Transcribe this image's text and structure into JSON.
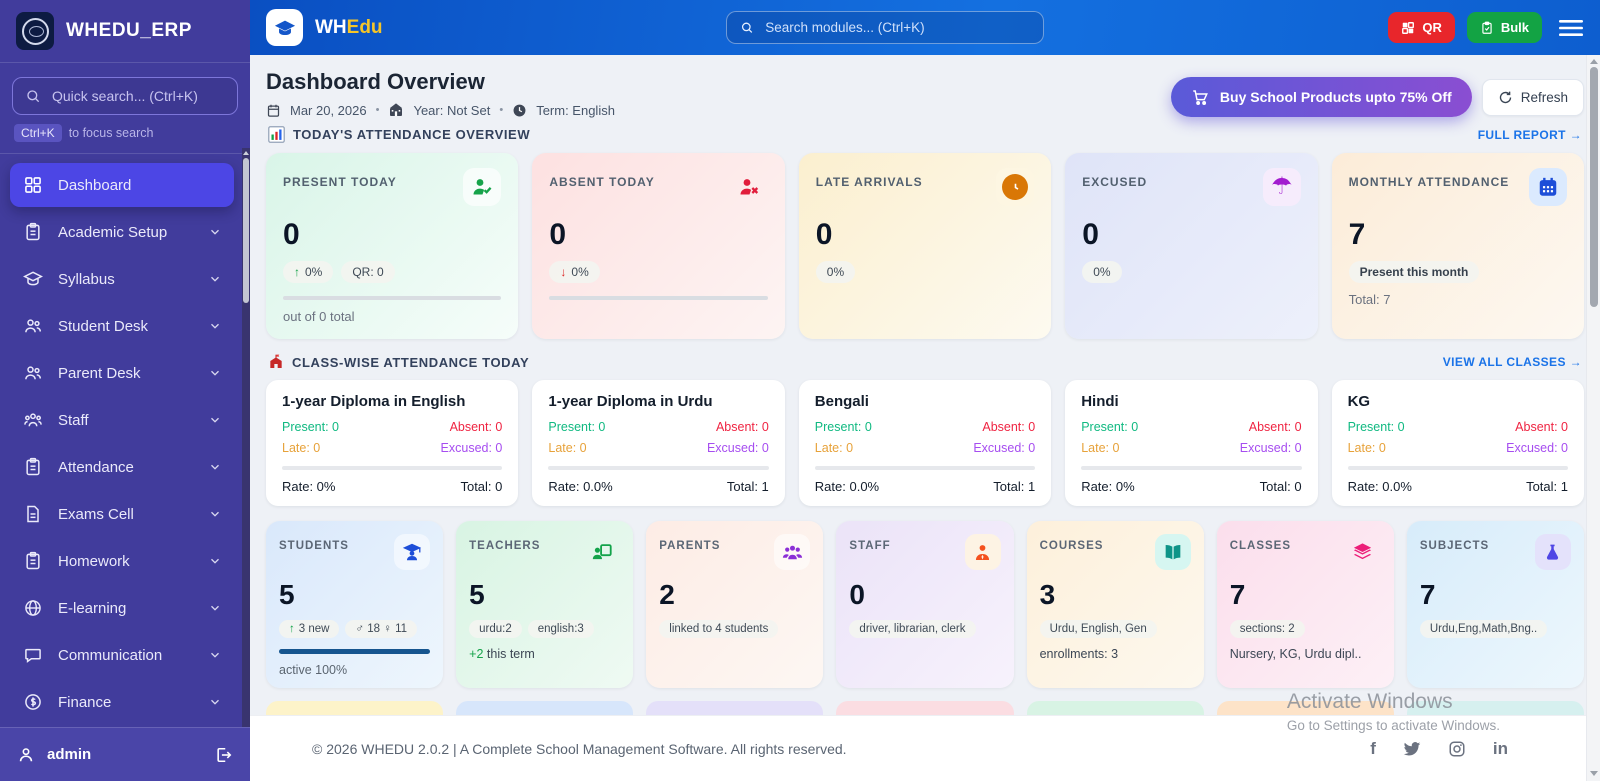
{
  "colors": {
    "sidebar_bg": "#413c9c",
    "sidebar_active": "#4c46e5",
    "navbar_blue_start": "#0a4fc2",
    "navbar_blue_end": "#0d5ecf",
    "qr_red": "#e8262b",
    "bulk_green": "#13a344",
    "link_blue": "#1a73e8",
    "buy_gradient_start": "#5a5ad8",
    "buy_gradient_end": "#8a4ed2",
    "present_green": "#10b981",
    "absent_red": "#ef2442",
    "late_orange": "#e7a23a",
    "excused_purple": "#a64df0"
  },
  "sidebar": {
    "brand": "WHEDU_ERP",
    "search_placeholder": "Quick search... (Ctrl+K)",
    "kbd": "Ctrl+K",
    "kbd_text": "to focus search",
    "items": [
      {
        "label": "Dashboard",
        "icon": "grid-icon",
        "active": true
      },
      {
        "label": "Academic Setup",
        "icon": "clipboard-icon"
      },
      {
        "label": "Syllabus",
        "icon": "graduation-cap-icon"
      },
      {
        "label": "Student Desk",
        "icon": "users-icon"
      },
      {
        "label": "Parent Desk",
        "icon": "users-icon"
      },
      {
        "label": "Staff",
        "icon": "people-group-icon"
      },
      {
        "label": "Attendance",
        "icon": "clipboard-icon"
      },
      {
        "label": "Exams Cell",
        "icon": "document-icon"
      },
      {
        "label": "Homework",
        "icon": "clipboard-icon"
      },
      {
        "label": "E-learning",
        "icon": "globe-icon"
      },
      {
        "label": "Communication",
        "icon": "chat-icon"
      },
      {
        "label": "Finance",
        "icon": "finance-icon"
      }
    ],
    "user": "admin"
  },
  "navbar": {
    "brand_wh": "WH",
    "brand_edu": "Edu",
    "search_placeholder": "Search modules... (Ctrl+K)",
    "qr": "QR",
    "bulk": "Bulk"
  },
  "header": {
    "title": "Dashboard Overview",
    "date": "Mar 20, 2026",
    "sep": "•",
    "year": "Year: Not Set",
    "term": "Term: English",
    "buy_button": "Buy School Products upto 75% Off",
    "refresh": "Refresh"
  },
  "attendance": {
    "section_title": "TODAY'S ATTENDANCE OVERVIEW",
    "link": "FULL REPORT →",
    "cards": [
      {
        "title": "PRESENT TODAY",
        "value": "0",
        "badges": [
          {
            "arrow": "↑",
            "text": "0%"
          },
          {
            "text": "QR: 0"
          }
        ],
        "sub": "out of 0 total"
      },
      {
        "title": "ABSENT TODAY",
        "value": "0",
        "badges": [
          {
            "arrow": "↓",
            "text": "0%"
          }
        ]
      },
      {
        "title": "LATE ARRIVALS",
        "value": "0",
        "badges": [
          {
            "text": "0%"
          }
        ]
      },
      {
        "title": "EXCUSED",
        "value": "0",
        "badges": [
          {
            "text": "0%"
          }
        ]
      },
      {
        "title": "MONTHLY ATTENDANCE",
        "value": "7",
        "badges": [
          {
            "text": "Present this month"
          }
        ],
        "sub": "Total: 7"
      }
    ]
  },
  "classwise": {
    "section_title": "CLASS-WISE ATTENDANCE TODAY",
    "link": "VIEW ALL CLASSES →",
    "cards": [
      {
        "name": "1-year Diploma in English",
        "present": "Present: 0",
        "absent": "Absent: 0",
        "late": "Late: 0",
        "excused": "Excused: 0",
        "rate": "Rate: 0%",
        "total": "Total: 0"
      },
      {
        "name": "1-year Diploma in Urdu",
        "present": "Present: 0",
        "absent": "Absent: 0",
        "late": "Late: 0",
        "excused": "Excused: 0",
        "rate": "Rate: 0.0%",
        "total": "Total: 1"
      },
      {
        "name": "Bengali",
        "present": "Present: 0",
        "absent": "Absent: 0",
        "late": "Late: 0",
        "excused": "Excused: 0",
        "rate": "Rate: 0.0%",
        "total": "Total: 1"
      },
      {
        "name": "Hindi",
        "present": "Present: 0",
        "absent": "Absent: 0",
        "late": "Late: 0",
        "excused": "Excused: 0",
        "rate": "Rate: 0%",
        "total": "Total: 0"
      },
      {
        "name": "KG",
        "present": "Present: 0",
        "absent": "Absent: 0",
        "late": "Late: 0",
        "excused": "Excused: 0",
        "rate": "Rate: 0.0%",
        "total": "Total: 1"
      }
    ]
  },
  "stats": {
    "cards": [
      {
        "title": "STUDENTS",
        "value": "5",
        "badges": [
          {
            "arrow": "↑",
            "text": "3 new"
          },
          {
            "text": "♂ 18 ♀ 11"
          }
        ],
        "sub": "active 100%"
      },
      {
        "title": "TEACHERS",
        "value": "5",
        "badges": [
          {
            "text": "urdu:2"
          },
          {
            "text": "english:3"
          }
        ],
        "sub_accent": "+2",
        "sub_rest": "this term"
      },
      {
        "title": "PARENTS",
        "value": "2",
        "badges": [
          {
            "text": "linked to 4 students"
          }
        ]
      },
      {
        "title": "STAFF",
        "value": "0",
        "badges": [
          {
            "text": "driver, librarian, clerk"
          }
        ]
      },
      {
        "title": "COURSES",
        "value": "3",
        "badges": [
          {
            "text": "Urdu, English, Gen"
          }
        ],
        "sub": "enrollments: 3"
      },
      {
        "title": "CLASSES",
        "value": "7",
        "badges": [
          {
            "text": "sections: 2"
          }
        ],
        "sub": "Nursery, KG, Urdu dipl.."
      },
      {
        "title": "SUBJECTS",
        "value": "7",
        "badges": [
          {
            "text": "Urdu,Eng,Math,Bng.."
          }
        ]
      }
    ]
  },
  "footer": {
    "copyright": "© 2026 WHEDU 2.0.2 | A Complete School Management Software. All rights reserved."
  },
  "watermark": {
    "line1": "Activate Windows",
    "line2": "Go to Settings to activate Windows."
  }
}
